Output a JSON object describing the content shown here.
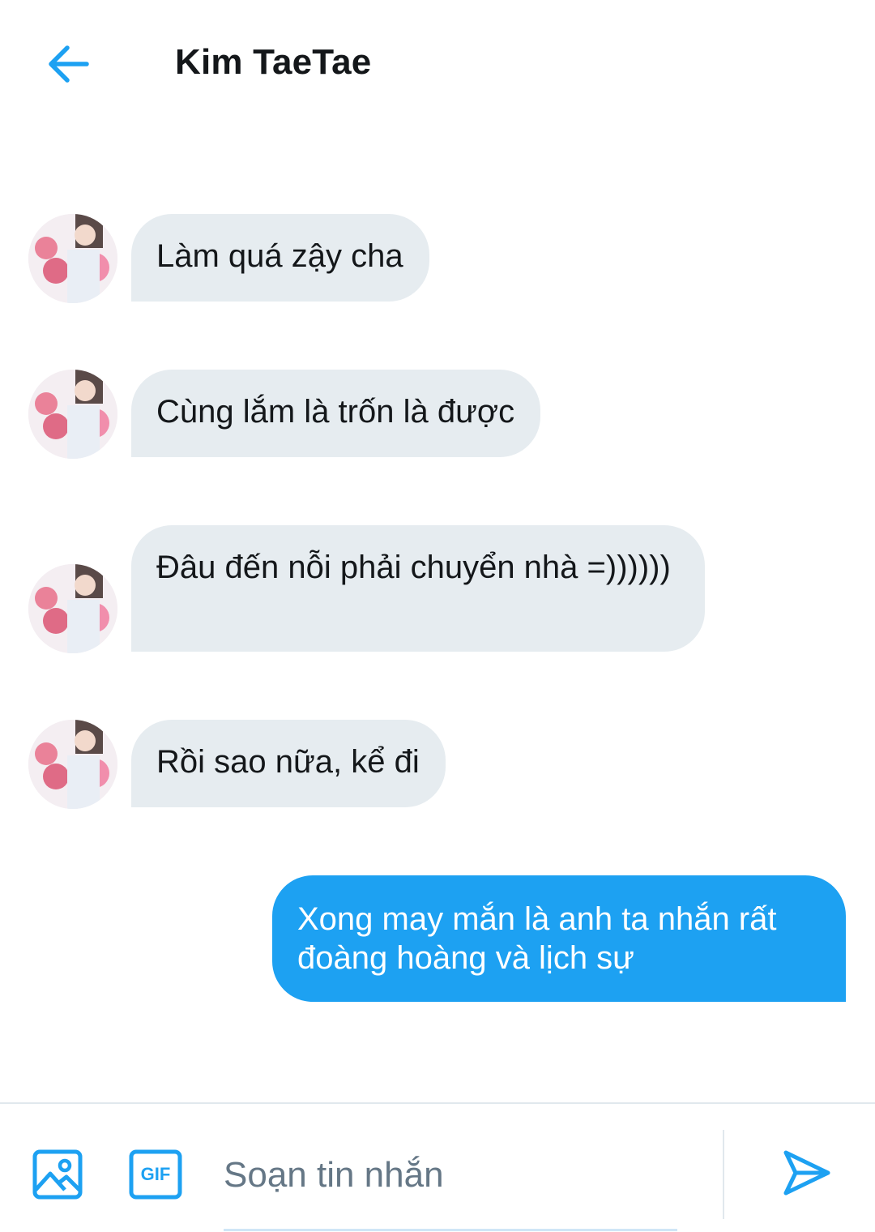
{
  "header": {
    "title": "Kim TaeTae",
    "back_icon": "arrow-left-icon"
  },
  "messages": [
    {
      "direction": "incoming",
      "text": "Làm quá zậy cha"
    },
    {
      "direction": "incoming",
      "text": "Cùng lắm là trốn là được"
    },
    {
      "direction": "incoming",
      "text": "Đâu đến nỗi phải chuyển nhà =))))))"
    },
    {
      "direction": "incoming",
      "text": "Rồi sao nữa, kể đi"
    },
    {
      "direction": "outgoing",
      "text": "Xong may mắn là anh ta nhắn rất đoàng hoàng và lịch sự"
    }
  ],
  "composer": {
    "placeholder": "Soạn tin nhắn",
    "value": "",
    "image_icon": "image-icon",
    "gif_label": "GIF",
    "send_icon": "send-icon"
  },
  "colors": {
    "accent": "#1da1f2",
    "incoming_bubble": "#e6ecf0",
    "title_text": "#14171a",
    "placeholder_text": "#657786"
  }
}
